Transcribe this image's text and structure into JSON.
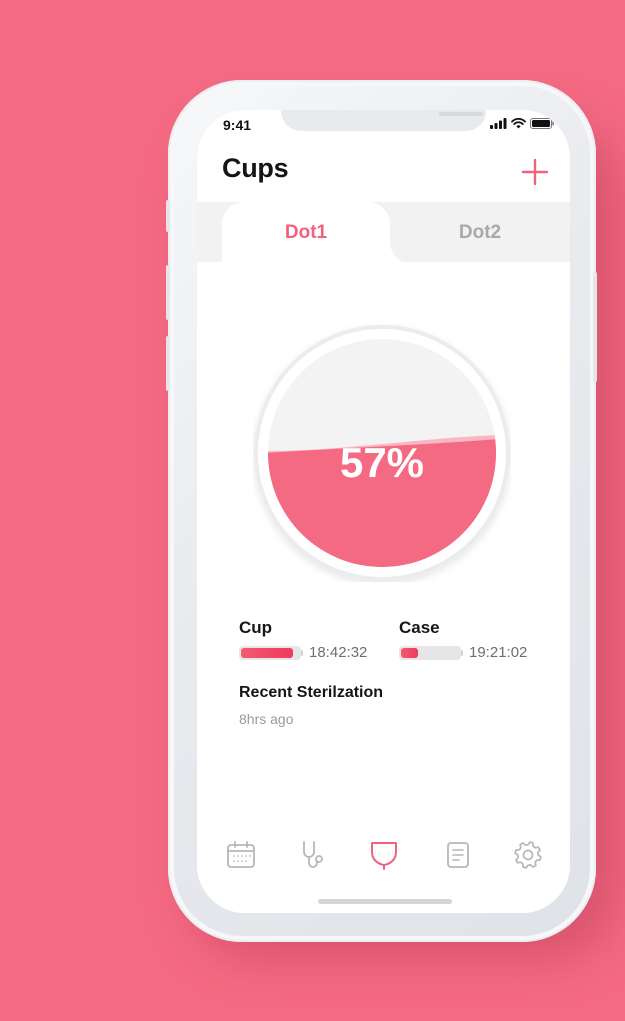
{
  "status_bar": {
    "time": "9:41"
  },
  "header": {
    "title": "Cups",
    "add_icon": "plus-icon"
  },
  "tabs": [
    {
      "label": "Dot1",
      "active": true
    },
    {
      "label": "Dot2",
      "active": false
    }
  ],
  "gauge": {
    "percent_label": "57%",
    "fill_fraction": 0.57,
    "fill_color": "#f46a82"
  },
  "stats": {
    "cup": {
      "label": "Cup",
      "time": "18:42:32",
      "level": 0.9
    },
    "case": {
      "label": "Case",
      "time": "19:21:02",
      "level": 0.3
    }
  },
  "recent": {
    "title": "Recent Sterilzation",
    "subtitle": "8hrs ago"
  },
  "bottom_nav": {
    "items": [
      {
        "icon": "calendar-icon",
        "active": false
      },
      {
        "icon": "stethoscope-icon",
        "active": false
      },
      {
        "icon": "cup-icon",
        "active": true
      },
      {
        "icon": "document-icon",
        "active": false
      },
      {
        "icon": "gear-icon",
        "active": false
      }
    ]
  },
  "colors": {
    "background": "#f46a82",
    "accent": "#f2627c",
    "inactive": "#b7b7ba"
  }
}
